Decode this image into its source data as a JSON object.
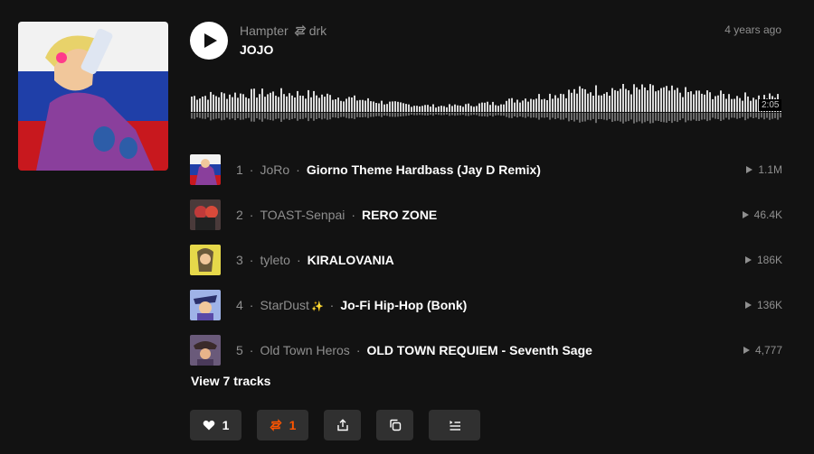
{
  "header": {
    "owner": "Hampter",
    "reposter": "drk",
    "title": "JOJO",
    "time_ago": "4 years ago",
    "duration": "2:05"
  },
  "icons": {
    "play": "play-icon",
    "repost": "repost-icon",
    "like": "heart-icon",
    "share": "share-icon",
    "copy": "copy-link-icon",
    "queue": "add-to-queue-icon"
  },
  "colors": {
    "background": "#121212",
    "accent": "#ff5500",
    "muted": "#8f8f8f",
    "button_bg": "#303030"
  },
  "tracks": [
    {
      "num": "1",
      "artist": "JoRo",
      "name": "Giorno Theme Hardbass (Jay D Remix)",
      "plays": "1.1M"
    },
    {
      "num": "2",
      "artist": "TOAST-Senpai",
      "name": "RERO ZONE",
      "plays": "46.4K"
    },
    {
      "num": "3",
      "artist": "tyleto",
      "name": "KIRALOVANIA",
      "plays": "186K"
    },
    {
      "num": "4",
      "artist": "StarDust",
      "name": "Jo-Fi Hip-Hop (Bonk)",
      "plays": "136K",
      "emoji": "✨"
    },
    {
      "num": "5",
      "artist": "Old Town Heros",
      "name": "OLD TOWN REQUIEM - Seventh Sage",
      "plays": "4,777"
    }
  ],
  "view_all": "View 7 tracks",
  "actions": {
    "like_count": "1",
    "repost_count": "1"
  }
}
